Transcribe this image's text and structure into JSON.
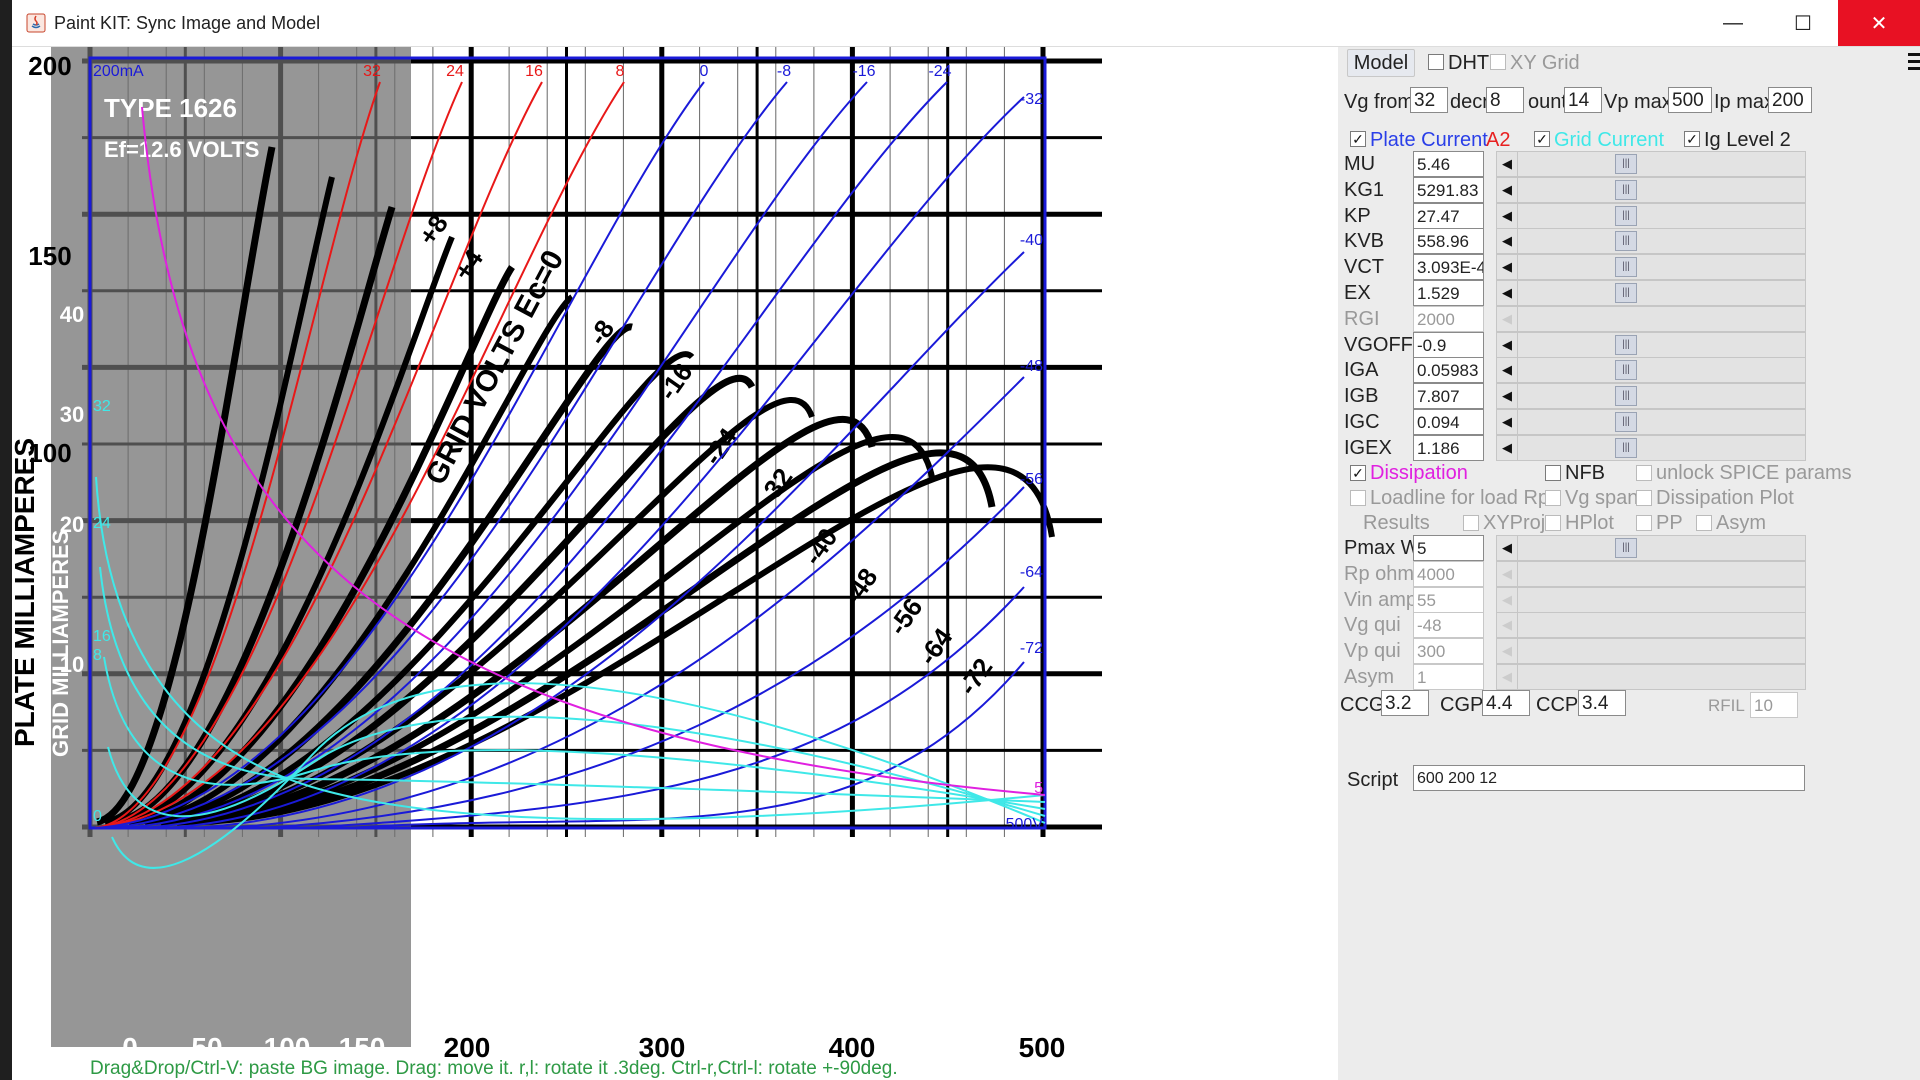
{
  "window": {
    "title": "Paint KIT: Sync Image and Model"
  },
  "plot": {
    "top_labels": [
      "32",
      "24",
      "16",
      "8",
      "0",
      "-8",
      "-16",
      "-24"
    ],
    "right_labels": [
      "-32",
      "-40",
      "-48",
      "-56",
      "-64",
      "-72"
    ],
    "corner_top_left": "200mA",
    "corner_bottom_right": "500V",
    "zero_label": "0",
    "cyan_labels": [
      "32",
      "24",
      "16",
      "8"
    ],
    "magenta_label": "5",
    "status": "Drag&Drop/Ctrl-V: paste BG image. Drag: move it. r,l: rotate it .3deg. Ctrl-r,Ctrl-l: rotate +-90deg.",
    "bg_x_ticks": [
      "0",
      "50",
      "100",
      "150",
      "200",
      "300",
      "400",
      "500"
    ],
    "bg_y_ticks": [
      "200",
      "150",
      "100"
    ],
    "bg_left_ticks": [
      "40",
      "30",
      "20",
      "10"
    ],
    "bg_left_title": "PLATE MILLIAMPERES",
    "bg_inner_title": "GRID MILLIAMPERES",
    "bg_type": "TYPE 1626",
    "bg_ef": "Ef=12.6 VOLTS",
    "bg_grid_volts": "GRID VOLTS Ec=0",
    "bg_curve_labels": [
      "+8",
      "+4",
      "-8",
      "-16",
      "-24",
      "-32",
      "-40",
      "-48",
      "-56",
      "-64",
      "-72"
    ]
  },
  "panel": {
    "model_button": "Model",
    "dht_label": "DHT",
    "xygrid_label": "XY Grid",
    "vg_from_label": "Vg from",
    "vg_from_value": "32",
    "decr_label": "decr",
    "decr_value": "8",
    "count_label": "ount",
    "count_value": "14",
    "vpmax_label": "Vp max",
    "vpmax_value": "500",
    "ipmax_label": "Ip max",
    "ipmax_value": "200",
    "plate_current_label": "Plate Current",
    "a2_label": "A2",
    "grid_current_label": "Grid Current",
    "ig_level_label": "Ig Level 2",
    "params": [
      {
        "name": "MU",
        "value": "5.46",
        "enabled": true
      },
      {
        "name": "KG1",
        "value": "5291.83",
        "enabled": true
      },
      {
        "name": "KP",
        "value": "27.47",
        "enabled": true
      },
      {
        "name": "KVB",
        "value": "558.96",
        "enabled": true
      },
      {
        "name": "VCT",
        "value": "3.093E-4",
        "enabled": true
      },
      {
        "name": "EX",
        "value": "1.529",
        "enabled": true
      },
      {
        "name": "RGI",
        "value": "2000",
        "enabled": false
      },
      {
        "name": "VGOFF",
        "value": "-0.9",
        "enabled": true
      },
      {
        "name": "IGA",
        "value": "0.05983",
        "enabled": true
      },
      {
        "name": "IGB",
        "value": "7.807",
        "enabled": true
      },
      {
        "name": "IGC",
        "value": "0.094",
        "enabled": true
      },
      {
        "name": "IGEX",
        "value": "1.186",
        "enabled": true
      }
    ],
    "dissipation_label": "Dissipation",
    "nfb_label": "NFB",
    "unlock_label": "unlock SPICE params",
    "loadline_label": "Loadline for load Rp",
    "vgspan_label": "Vg span",
    "dissplot_label": "Dissipation Plot",
    "results_label": "Results",
    "xyproj_label": "XYProj",
    "hplot_label": "HPlot",
    "pp_label": "PP",
    "asym_cb_label": "Asym",
    "params2": [
      {
        "name": "Pmax W",
        "value": "5",
        "enabled": true
      },
      {
        "name": "Rp ohm",
        "value": "4000",
        "enabled": false
      },
      {
        "name": "Vin ampl",
        "value": "55",
        "enabled": false
      },
      {
        "name": "Vg qui",
        "value": "-48",
        "enabled": false
      },
      {
        "name": "Vp qui",
        "value": "300",
        "enabled": false
      },
      {
        "name": "Asym",
        "value": "1",
        "enabled": false
      }
    ],
    "ccg_label": "CCG",
    "ccg_value": "3.2",
    "cgp_label": "CGP",
    "cgp_value": "4.4",
    "ccp_label": "CCP",
    "ccp_value": "3.4",
    "rfil_label": "RFIL",
    "rfil_value": "10",
    "script_label": "Script",
    "script_value": "600 200 12"
  }
}
